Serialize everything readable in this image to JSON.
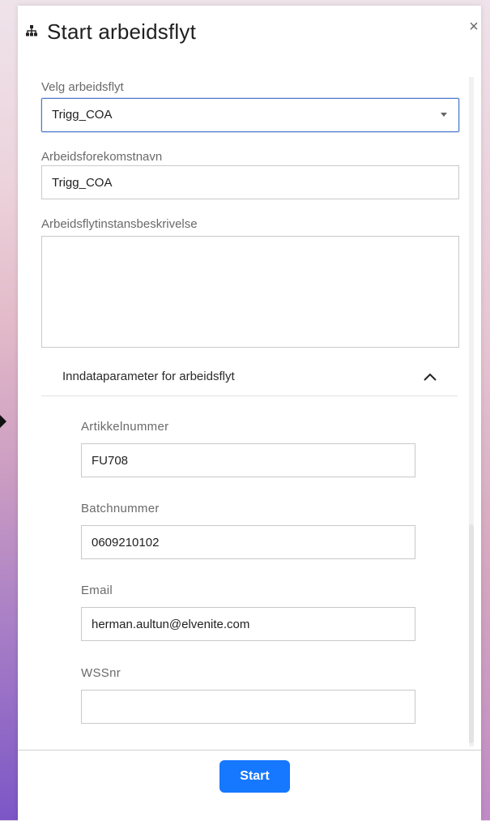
{
  "dialog": {
    "title": "Start arbeidsflyt",
    "close_symbol": "×",
    "icons": {
      "title_icon": "sitemap-icon",
      "close_icon": "close-icon",
      "select_icon": "caret-down-icon",
      "accordion_icon": "chevron-up-icon"
    },
    "colors": {
      "accent": "#1677ff",
      "select_border": "#4a78c9"
    }
  },
  "form": {
    "workflow_select": {
      "label": "Velg arbeidsflyt",
      "value": "Trigg_COA"
    },
    "instance_name": {
      "label": "Arbeidsforekomstnavn",
      "value": "Trigg_COA"
    },
    "description": {
      "label": "Arbeidsflytinstansbeskrivelse",
      "value": ""
    }
  },
  "params": {
    "section_title": "Inndataparameter for arbeidsflyt",
    "fields": [
      {
        "label": "Artikkelnummer",
        "value": "FU708"
      },
      {
        "label": "Batchnummer",
        "value": "0609210102"
      },
      {
        "label": "Email",
        "value": "herman.aultun@elvenite.com"
      },
      {
        "label": "WSSnr",
        "value": ""
      }
    ]
  },
  "footer": {
    "start_label": "Start"
  }
}
